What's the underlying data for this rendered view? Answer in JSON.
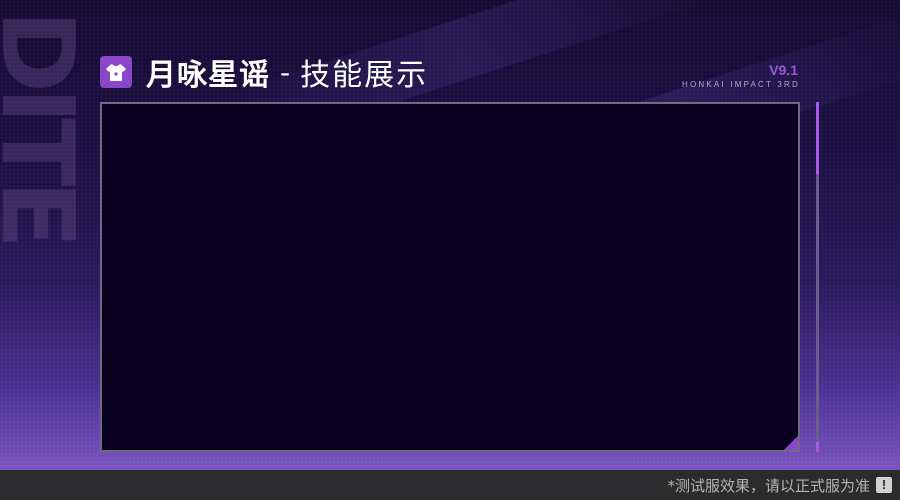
{
  "header": {
    "icon": "tshirt-icon",
    "title": "月咏星谣",
    "separator": "-",
    "subtitle": "技能展示",
    "version": "V9.1",
    "game_name": "HONKAI IMPACT 3RD"
  },
  "background": {
    "watermark_text": "DITE"
  },
  "footer": {
    "disclaimer": "*测试服效果，请以正式服为准",
    "warning_icon": "exclamation-icon",
    "warning_glyph": "!"
  },
  "colors": {
    "accent": "#8a45c9",
    "video_bg": "#0a0020",
    "footer_bg": "#2b2b2d"
  }
}
